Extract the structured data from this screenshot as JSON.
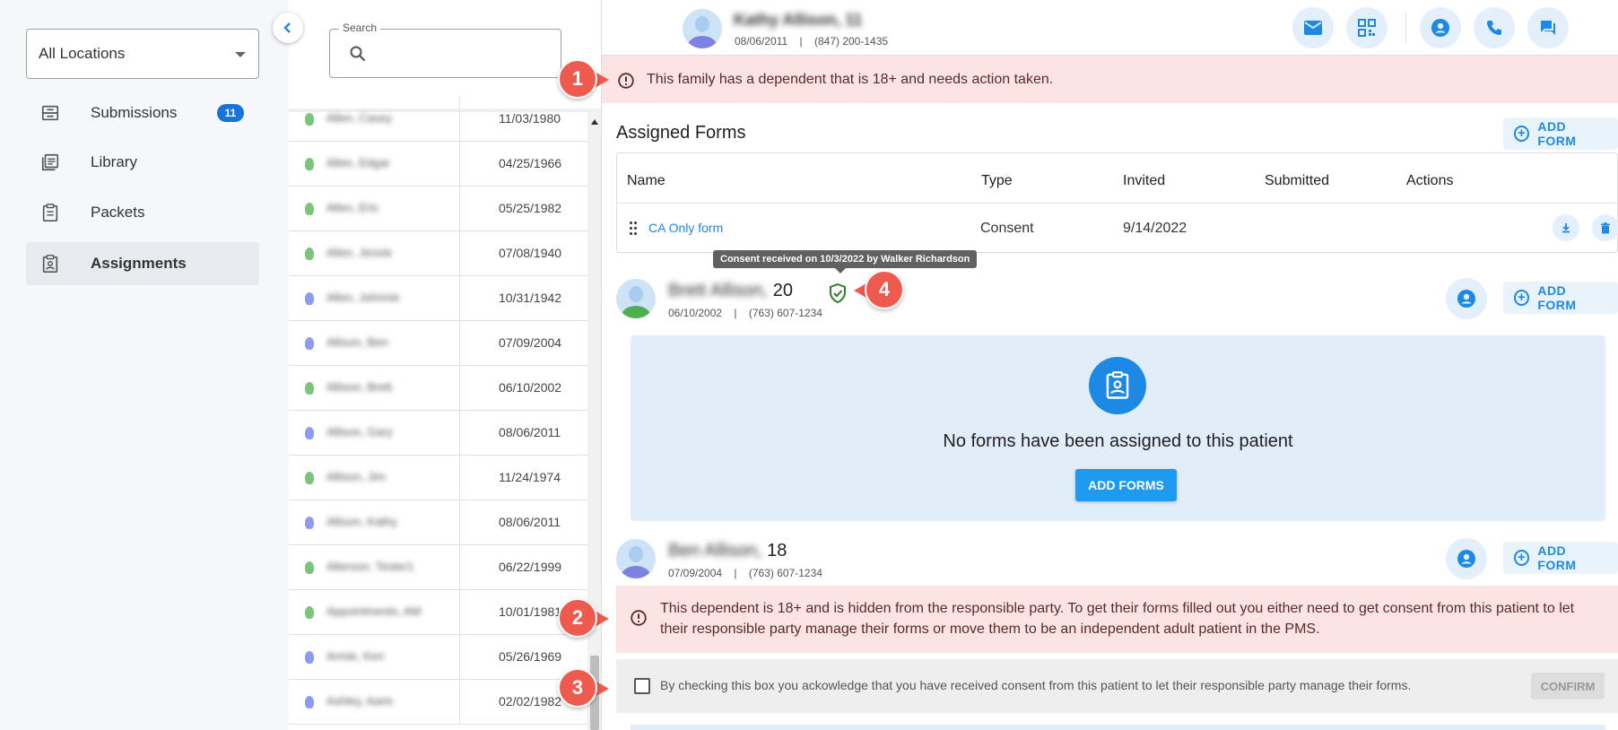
{
  "sidebar": {
    "location_select": "All Locations",
    "nav": [
      {
        "label": "Submissions",
        "badge": "11"
      },
      {
        "label": "Library"
      },
      {
        "label": "Packets"
      },
      {
        "label": "Assignments"
      }
    ]
  },
  "patient_list": {
    "search_label": "Search",
    "rows": [
      {
        "name": "Allen, Casey",
        "date": "11/03/1980",
        "color": "#7cc47c"
      },
      {
        "name": "Allen, Edgar",
        "date": "04/25/1966",
        "color": "#7cc47c"
      },
      {
        "name": "Allen, Eric",
        "date": "05/25/1982",
        "color": "#7cc47c"
      },
      {
        "name": "Allen, Jessie",
        "date": "07/08/1940",
        "color": "#7cc47c"
      },
      {
        "name": "Allen, Johnnie",
        "date": "10/31/1942",
        "color": "#8e9bf0"
      },
      {
        "name": "Allison, Ben",
        "date": "07/09/2004",
        "color": "#8e9bf0"
      },
      {
        "name": "Allison, Brett",
        "date": "06/10/2002",
        "color": "#7cc47c"
      },
      {
        "name": "Allison, Gary",
        "date": "08/06/2011",
        "color": "#8e9bf0"
      },
      {
        "name": "Allison, Jim",
        "date": "11/24/1974",
        "color": "#7cc47c"
      },
      {
        "name": "Allison, Kathy",
        "date": "08/06/2011",
        "color": "#8e9bf0"
      },
      {
        "name": "Alterson, Tester1",
        "date": "06/22/1999",
        "color": "#7cc47c"
      },
      {
        "name": "Appointments, AM",
        "date": "10/01/1981",
        "color": "#7cc47c"
      },
      {
        "name": "Armie, Ken",
        "date": "05/26/1969",
        "color": "#8e9bf0"
      },
      {
        "name": "Ashley, Aaris",
        "date": "02/02/1982",
        "color": "#8e9bf0"
      }
    ]
  },
  "header": {
    "name": "Kathy Allison, 11",
    "dob": "08/06/2011",
    "separator": "|",
    "phone": "(847) 200-1435",
    "actions": [
      "mail-icon",
      "qr-code-icon",
      "account-icon",
      "phone-icon",
      "chat-icon"
    ]
  },
  "family_alert": "This family has a dependent that is 18+ and needs action taken.",
  "assigned_forms": {
    "title": "Assigned Forms",
    "add_label": "ADD FORM",
    "columns": [
      "Name",
      "Type",
      "Invited",
      "Submitted",
      "Actions"
    ],
    "rows": [
      {
        "name": "CA Only form",
        "type": "Consent",
        "invited": "9/14/2022",
        "submitted": ""
      }
    ]
  },
  "tooltip": "Consent received on 10/3/2022 by Walker Richardson",
  "dependents": [
    {
      "name_blur": "Brett Allison,",
      "age": "20",
      "dob": "06/10/2002",
      "phone": "(763) 607-1234",
      "add_label": "ADD FORM",
      "empty_text": "No forms have been assigned to this patient",
      "add_forms_label": "ADD FORMS"
    },
    {
      "name_blur": "Ben Allison,",
      "age": "18",
      "dob": "07/09/2004",
      "phone": "(763) 607-1234",
      "add_label": "ADD FORM",
      "alert": "This dependent is 18+ and is hidden from the responsible party. To get their forms filled out you either need to get consent from this patient to let their responsible party manage their forms or move them to be an independent adult patient in the PMS.",
      "consent_text": "By checking this box you ackowledge that you have received consent from this patient to let their responsible party manage their forms.",
      "confirm_label": "CONFIRM"
    }
  ],
  "markers": [
    "1",
    "2",
    "3",
    "4"
  ],
  "colors": {
    "accent": "#1e88e5",
    "alert_bg": "#fce4e4",
    "marker": "#ef5a4f",
    "badge": "#1673d9"
  }
}
